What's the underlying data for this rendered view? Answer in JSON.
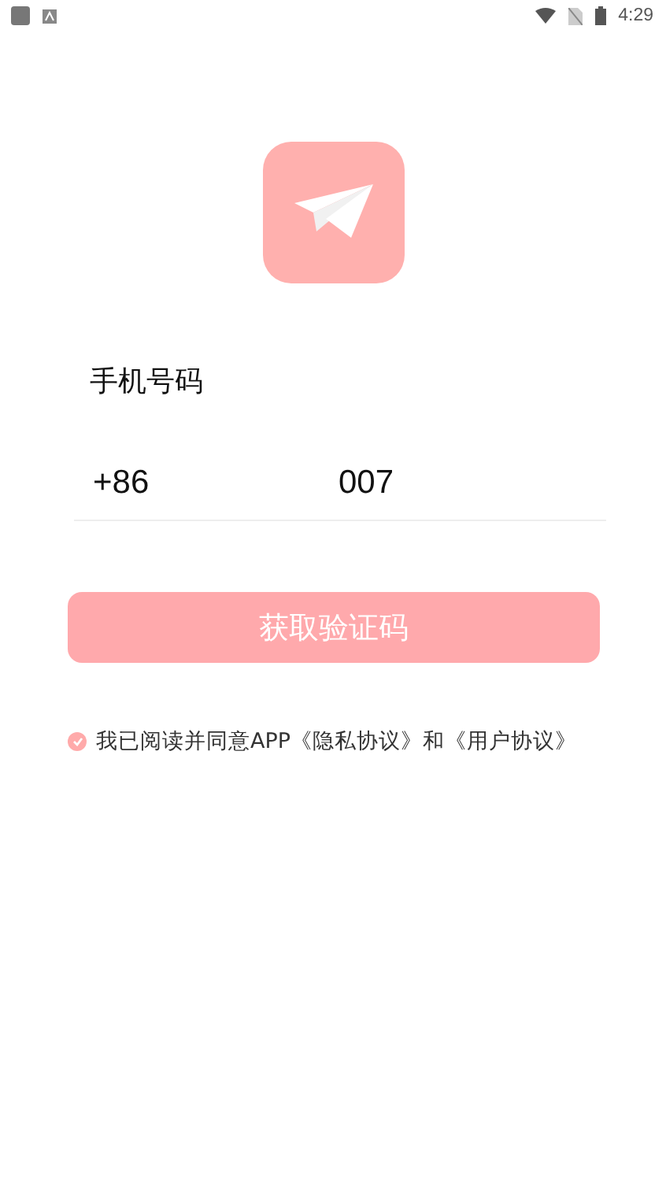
{
  "status_bar": {
    "time": "4:29"
  },
  "phone": {
    "label": "手机号码",
    "country_code": "+86",
    "value": "007"
  },
  "submit": {
    "label": "获取验证码",
    "disabled": true
  },
  "agreement": {
    "checked": true,
    "text": "我已阅读并同意APP《隐私协议》和《用户协议》"
  }
}
